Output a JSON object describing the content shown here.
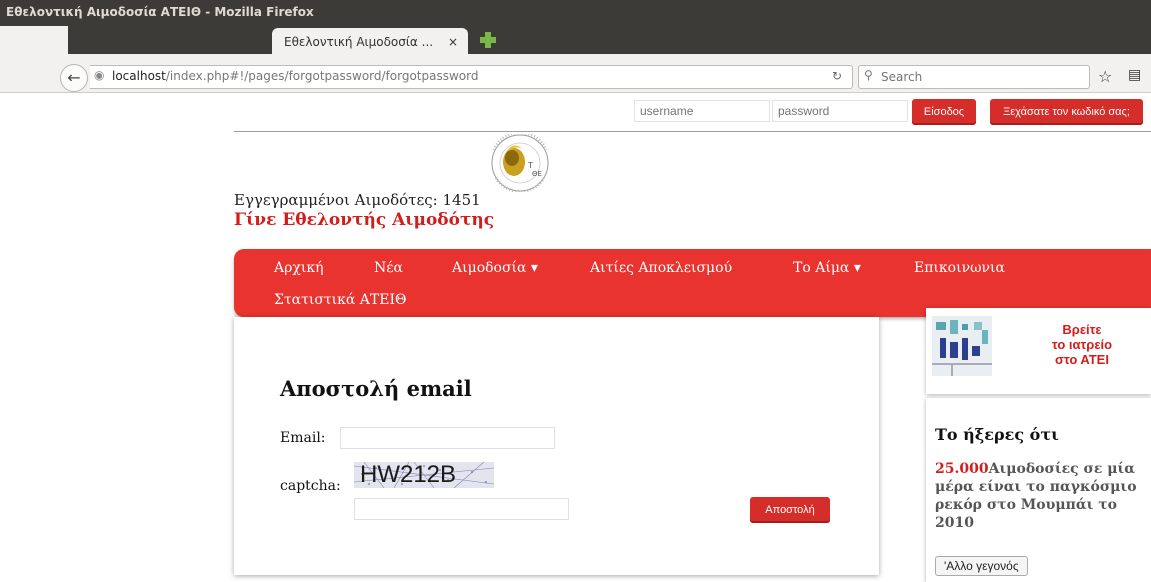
{
  "window": {
    "title": "Εθελοντική Αιμοδοσία ΑΤΕΙΘ - Mozilla Firefox"
  },
  "browser": {
    "tab_label": "Εθελοντική Αιμοδοσία ...",
    "tab_close": "×",
    "url_host": "localhost",
    "url_path": "/index.php#!/pages/forgotpassword/forgotpassword",
    "search_placeholder": "Search"
  },
  "login": {
    "username_placeholder": "username",
    "password_placeholder": "password",
    "login_button": "Είσοδος",
    "forgot_button": "Ξεχάσατε τον κωδικό σας;"
  },
  "header": {
    "registered_donors": "Εγγεγραμμένοι Αιμοδότες: 1451",
    "slogan": "Γίνε Εθελοντής Αιμοδότης",
    "logo_text": "ΑΛΕΞΑΝΔΡΕΙΟ ΤΕΧΝΟΛΟΓΙΚΟ ΕΚΠΑΙΔΕΥΤΙΚΟ ΙΔΡΥΜΑ ΘΕΣΣΑΛΟΝΙΚΗΣ"
  },
  "nav": {
    "items": [
      {
        "label": "Αρχική"
      },
      {
        "label": "Νέα"
      },
      {
        "label": "Αιμοδοσία ▾"
      },
      {
        "label": "Αιτίες Αποκλεισμού"
      },
      {
        "label": "Το Αίμα ▾"
      },
      {
        "label": "Επικοινωνια"
      },
      {
        "label": "Στατιστικά ΑΤΕΙΘ"
      }
    ]
  },
  "form": {
    "title": "Αποστολή email",
    "email_label": "Email:",
    "captcha_label": "captcha:",
    "captcha_text": "HW212B",
    "submit_button": "Αποστολή"
  },
  "sidebar": {
    "find_clinic": [
      "Βρείτε",
      "το ιατρείο",
      "στο ΑΤΕΙ"
    ],
    "fact_title": "Το ήξερες ότι",
    "fact_number": "25.000",
    "fact_text": "Αιμοδοσίες σε μία μέρα είναι το παγκόσμιο ρεκόρ στο Μουμπάι το 2010",
    "another_fact_button": "'Αλλο γεγονός"
  },
  "colors": {
    "accent_red": "#e8332f",
    "dark_red": "#d31d1b",
    "titlebar": "#3c3b37"
  }
}
